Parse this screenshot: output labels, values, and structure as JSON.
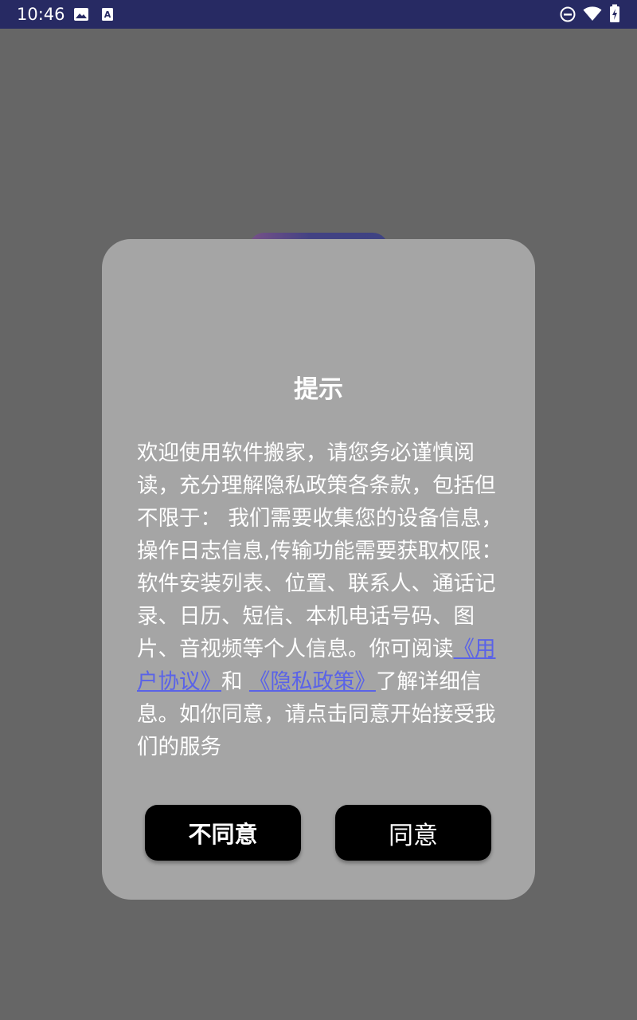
{
  "status_bar": {
    "time": "10:46",
    "icons": [
      "image-icon",
      "keyboard-a-icon",
      "dnd-icon",
      "wifi-icon",
      "battery-charging-icon"
    ],
    "background": "#272a63"
  },
  "dialog": {
    "title": "提示",
    "body_text_1": "欢迎使用软件搬家，请您务必谨慎阅读，充分理解隐私政策各条款，包括但不限于： 我们需要收集您的设备信息，操作日志信息,传输功能需要获取权限：软件安装列表、位置、联系人、通话记录、日历、短信、本机电话号码、图 片、音视频等个人信息。你可阅读",
    "link_user_agreement": "《用户协议》",
    "body_text_2": "和 ",
    "link_privacy_policy": "《隐私政策》",
    "body_text_3": "了解详细信息。如你同意，请点击同意开始接受我们的服务",
    "disagree_label": "不同意",
    "agree_label": "同意",
    "link_color": "#5a63e8",
    "background": "#a5a5a5"
  }
}
